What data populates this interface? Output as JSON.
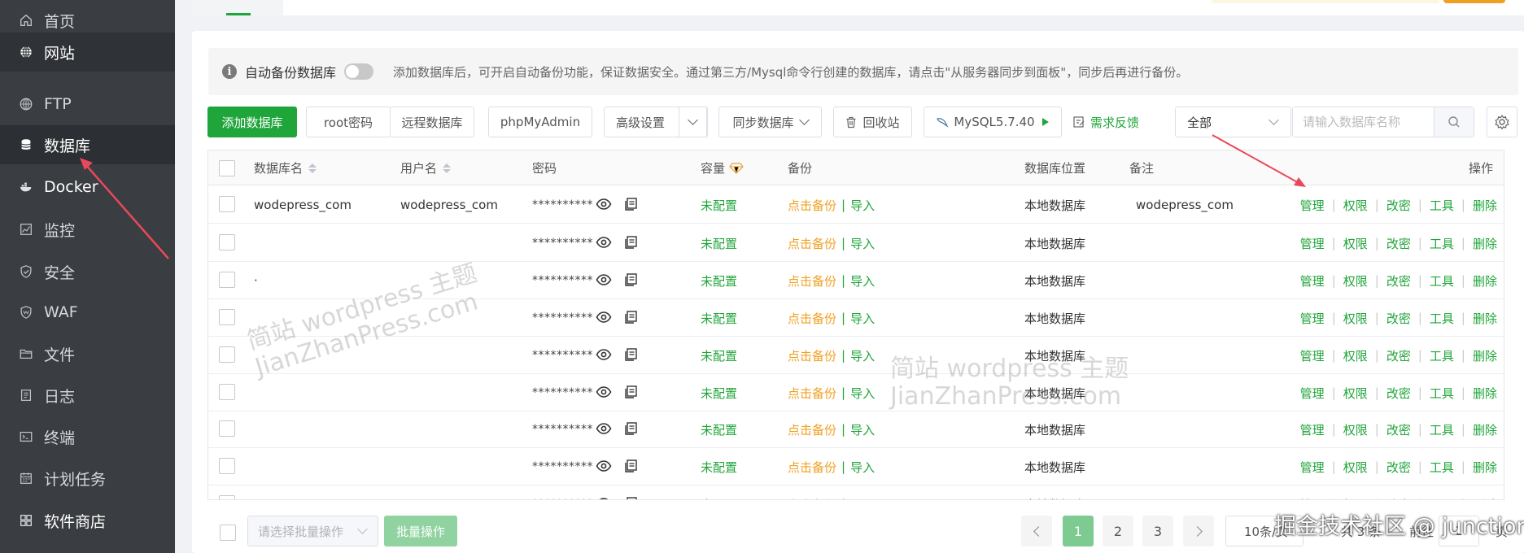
{
  "sidebar": {
    "items": [
      {
        "label": "首页",
        "icon": "home-icon",
        "name": "home"
      },
      {
        "label": "网站",
        "icon": "globe-icon",
        "name": "website"
      },
      {
        "label": "FTP",
        "icon": "ftp-globe-icon",
        "name": "ftp"
      },
      {
        "label": "数据库",
        "icon": "database-icon",
        "name": "database"
      },
      {
        "label": "Docker",
        "icon": "docker-icon",
        "name": "docker"
      },
      {
        "label": "监控",
        "icon": "monitor-chart-icon",
        "name": "monitor"
      },
      {
        "label": "安全",
        "icon": "shield-icon",
        "name": "security"
      },
      {
        "label": "WAF",
        "icon": "waf-shield-icon",
        "name": "waf"
      },
      {
        "label": "文件",
        "icon": "folder-icon",
        "name": "files"
      },
      {
        "label": "日志",
        "icon": "log-icon",
        "name": "logs"
      },
      {
        "label": "终端",
        "icon": "terminal-icon",
        "name": "terminal"
      },
      {
        "label": "计划任务",
        "icon": "calendar-icon",
        "name": "cron"
      },
      {
        "label": "软件商店",
        "icon": "app-store-icon",
        "name": "store"
      }
    ]
  },
  "notice": {
    "label": "自动备份数据库",
    "text": "添加数据库后，可开启自动备份功能，保证数据安全。通过第三方/Mysql命令行创建的数据库，请点击\"从服务器同步到面板\"，同步后再进行备份。"
  },
  "toolbar": {
    "add_db": "添加数据库",
    "root_pw": "root密码",
    "remote_db": "远程数据库",
    "phpmyadmin": "phpMyAdmin",
    "advanced": "高级设置",
    "sync_db": "同步数据库",
    "recycle": "回收站",
    "mysql_version": "MySQL5.7.40",
    "feedback": "需求反馈",
    "filter_selected": "全部",
    "search_placeholder": "请输入数据库名称"
  },
  "table": {
    "headers": {
      "name": "数据库名",
      "user": "用户名",
      "password": "密码",
      "capacity": "容量",
      "backup": "备份",
      "location": "数据库位置",
      "note": "备注",
      "ops": "操作"
    },
    "rows": [
      {
        "name": "wodepress_com",
        "user": "wodepress_com",
        "password": "**********",
        "capacity": "未配置",
        "backup": "点击备份",
        "import": "导入",
        "location": "本地数据库",
        "note": "wodepress_com"
      },
      {
        "name": "",
        "user": "",
        "password": "**********",
        "capacity": "未配置",
        "backup": "点击备份",
        "import": "导入",
        "location": "本地数据库",
        "note": ""
      },
      {
        "name": "·",
        "user": "",
        "password": "**********",
        "capacity": "未配置",
        "backup": "点击备份",
        "import": "导入",
        "location": "本地数据库",
        "note": ""
      },
      {
        "name": "",
        "user": "",
        "password": "**********",
        "capacity": "未配置",
        "backup": "点击备份",
        "import": "导入",
        "location": "本地数据库",
        "note": ""
      },
      {
        "name": "",
        "user": "",
        "password": "**********",
        "capacity": "未配置",
        "backup": "点击备份",
        "import": "导入",
        "location": "本地数据库",
        "note": ""
      },
      {
        "name": "",
        "user": "",
        "password": "**********",
        "capacity": "未配置",
        "backup": "点击备份",
        "import": "导入",
        "location": "本地数据库",
        "note": ""
      },
      {
        "name": "",
        "user": "",
        "password": "**********",
        "capacity": "未配置",
        "backup": "点击备份",
        "import": "导入",
        "location": "本地数据库",
        "note": ""
      },
      {
        "name": "",
        "user": "",
        "password": "**********",
        "capacity": "未配置",
        "backup": "点击备份",
        "import": "导入",
        "location": "本地数据库",
        "note": ""
      },
      {
        "name": "",
        "user": "",
        "password": "**********",
        "capacity": "未配置",
        "backup": "点击备份",
        "import": "导入",
        "location": "本地数据库",
        "note": ""
      }
    ],
    "ops": [
      "管理",
      "权限",
      "改密",
      "工具",
      "删除"
    ]
  },
  "footer": {
    "batch_placeholder": "请选择批量操作",
    "batch_button": "批量操作",
    "pages": [
      "1",
      "2",
      "3"
    ],
    "current_page": "1",
    "page_size": "10条/页",
    "total_text": "共 3 条",
    "goto_text": "前往",
    "goto_value": "1",
    "page_unit": "页"
  },
  "watermarks": {
    "line1": "简站 wordpress 主题",
    "line2": "JianZhanPress.com",
    "corner": "掘金技术社区 @ junction"
  },
  "colors": {
    "accent": "#20a53a",
    "sidebar_bg": "#3a3d42",
    "warning": "#f0a020",
    "arrow": "#e8495a"
  }
}
